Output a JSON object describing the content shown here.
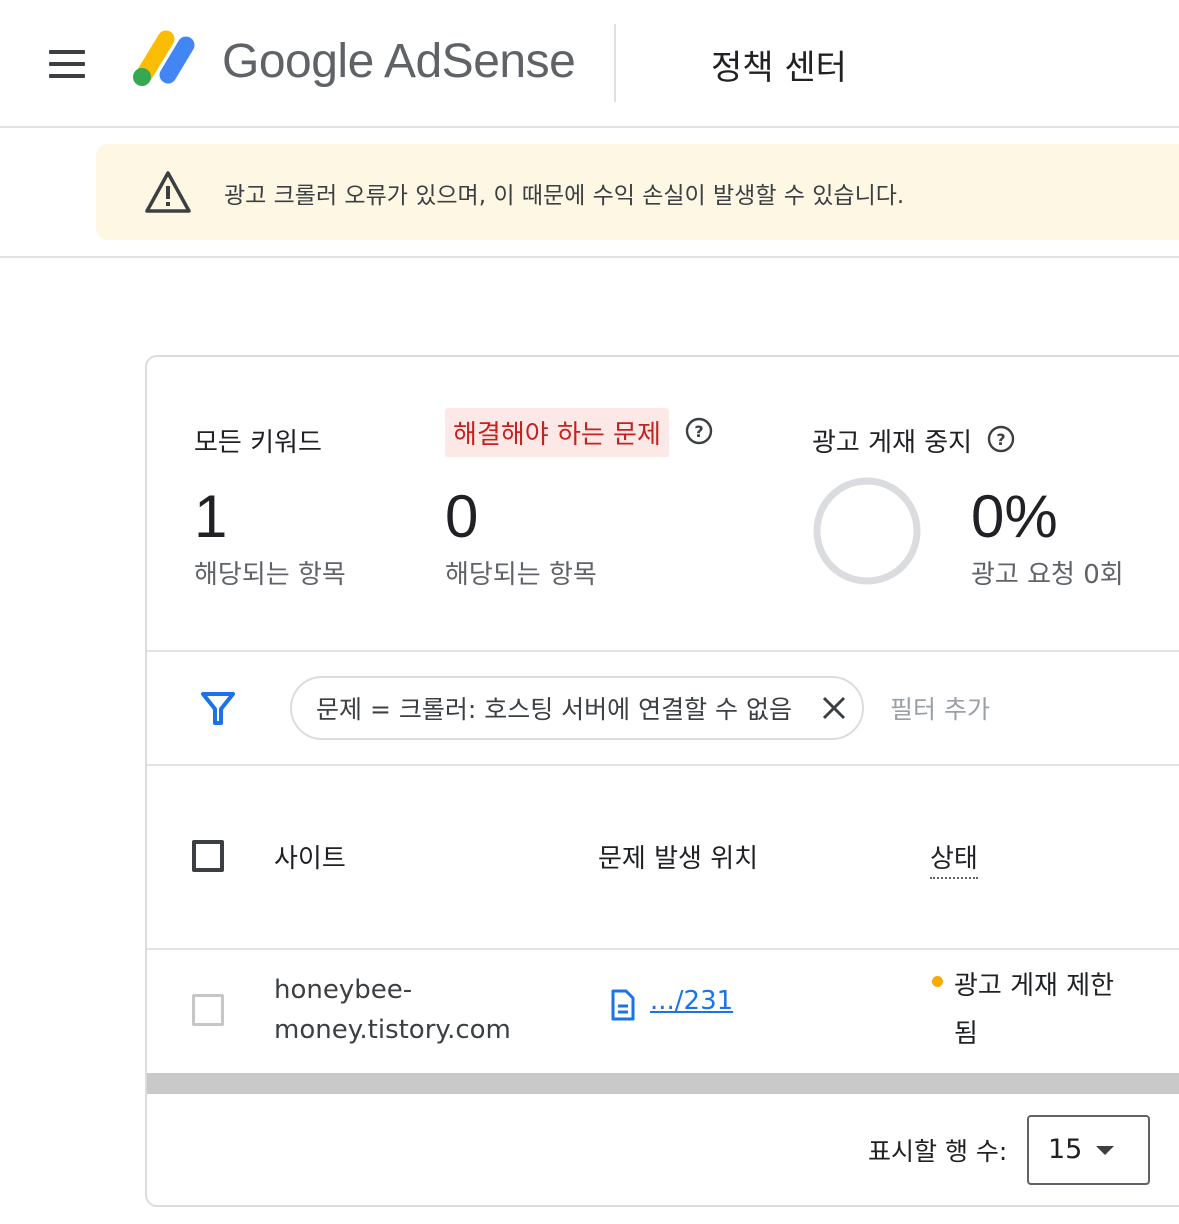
{
  "header": {
    "brand": "Google AdSense",
    "section_title": "정책 센터"
  },
  "alert": {
    "text": "광고 크롤러 오류가 있으며, 이 때문에 수익 손실이 발생할 수 있습니다."
  },
  "stats": [
    {
      "label": "모든 키워드",
      "value": "1",
      "sub": "해당되는 항목"
    },
    {
      "label": "해결해야 하는 문제",
      "value": "0",
      "sub": "해당되는 항목"
    },
    {
      "label": "광고 게재 중지",
      "value": "0%",
      "sub": "광고 요청 0회",
      "fill": 0
    }
  ],
  "filter": {
    "chip_text": "문제 = 크롤러: 호스팅 서버에 연결할 수 없음",
    "add_filter": "필터 추가"
  },
  "table": {
    "columns": [
      "사이트",
      "문제 발생 위치",
      "상태"
    ],
    "rows": [
      {
        "site_line1": "honeybee-",
        "site_line2": "money.tistory.com",
        "location": ".../231",
        "status_line1": "광고 게재 제한",
        "status_line2": "됨",
        "status_color": "#f9ab00"
      }
    ]
  },
  "pagination": {
    "rows_label": "표시할 행 수:",
    "rows_value": "15"
  },
  "colors": {
    "accent_blue": "#1a73e8",
    "alert_bg": "#fdf7e3",
    "chip_red_bg": "#fce8e6",
    "chip_red_text": "#c5221f",
    "status_yellow": "#f9ab00"
  }
}
